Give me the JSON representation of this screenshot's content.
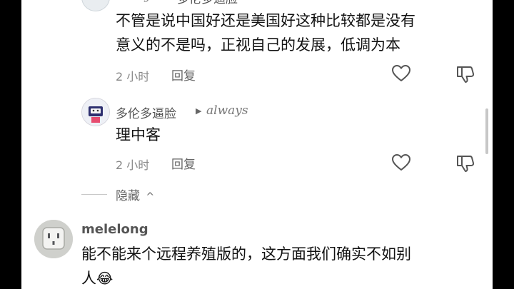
{
  "top_comment": {
    "reply_to": "always",
    "reply_to_name": "多伦多逼脸",
    "text_line1": "不管是说中国好还是美国好这种比较都是没有",
    "text_line2": "意义的不是吗，正视自己的发展，低调为本",
    "time": "2 小时",
    "reply_label": "回复"
  },
  "reply": {
    "author": "多伦多逼脸",
    "reply_to": "always",
    "text": "理中客",
    "time": "2 小时",
    "reply_label": "回复"
  },
  "collapse": {
    "label": "隐藏",
    "chevron": "^"
  },
  "next_comment": {
    "author": "melelong",
    "text_line1": "能不能来个远程养殖版的，这方面我们确实不如别",
    "text_line2": "人",
    "emoji": "😂"
  },
  "icons": {
    "like": "heart-outline-icon",
    "dislike": "thumbs-down-icon",
    "reply_arrow": "triangle-right-icon"
  }
}
